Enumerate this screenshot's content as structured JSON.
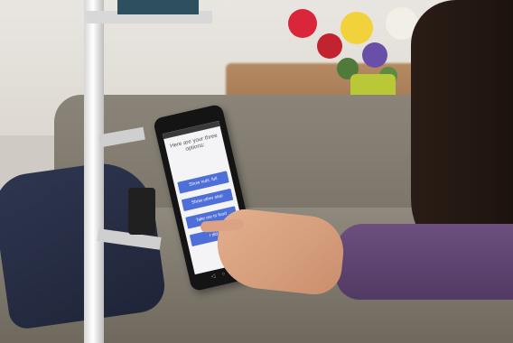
{
  "tablet_app": {
    "prompt": "Here are your three options:",
    "options": [
      "Show nuts. full",
      "Show other step",
      "Take me to food",
      "I did it"
    ],
    "nav_icons": "◁ ○ □"
  }
}
